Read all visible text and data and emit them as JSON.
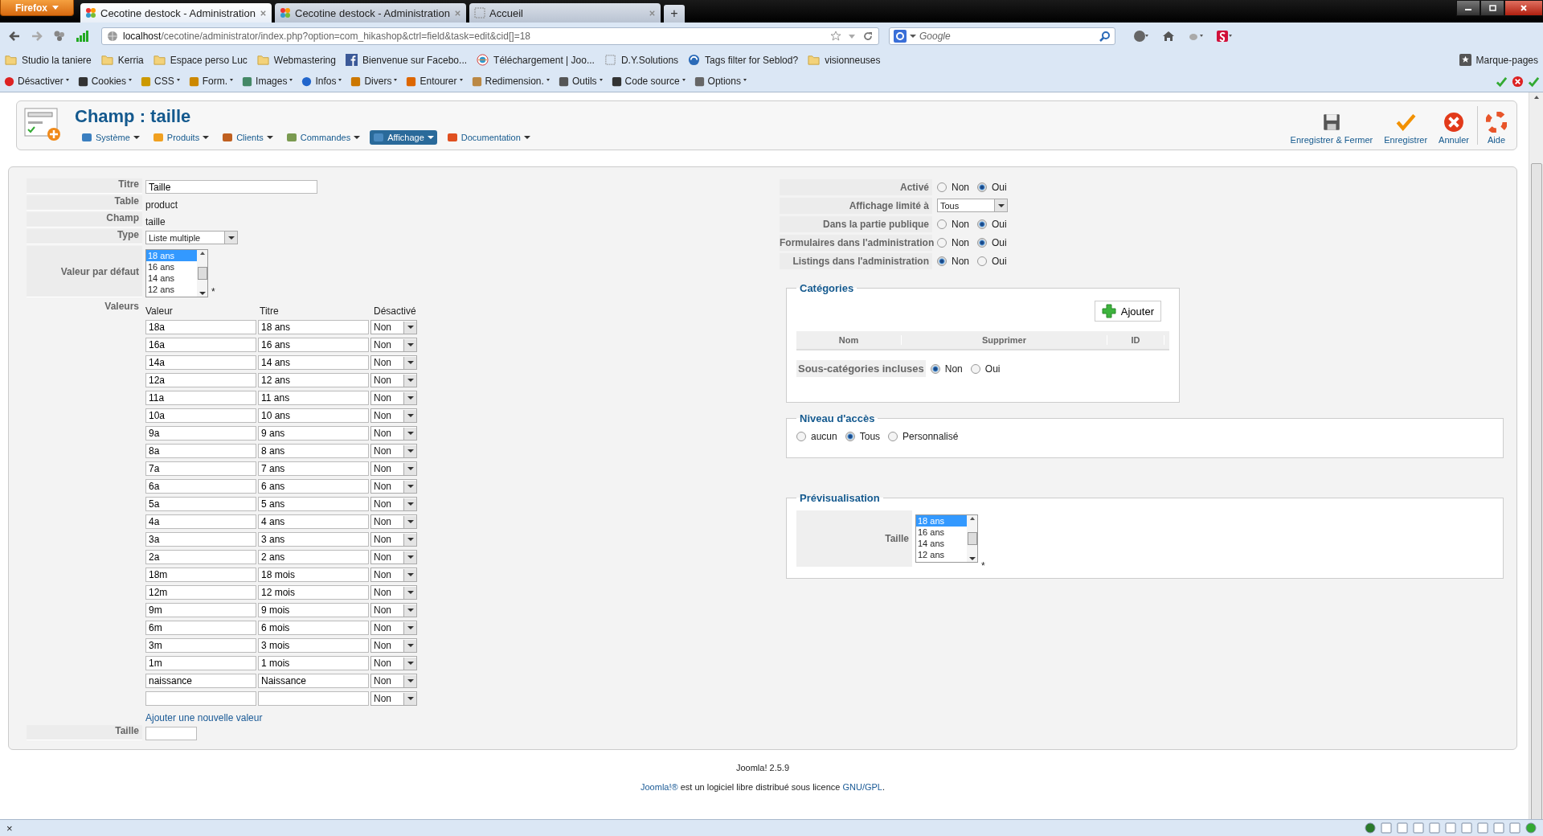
{
  "browser": {
    "app_button": "Firefox",
    "tabs": [
      {
        "title": "Cecotine destock - Administration",
        "selected": true
      },
      {
        "title": "Cecotine destock - Administration",
        "selected": false
      },
      {
        "title": "Accueil",
        "selected": false
      }
    ],
    "new_tab": "+",
    "url_host": "localhost",
    "url_path": "/cecotine/administrator/index.php?option=com_hikashop&ctrl=field&task=edit&cid[]=18",
    "search_placeholder": "Google",
    "bookmarks": [
      "Studio la taniere",
      "Kerria",
      "Espace perso Luc",
      "Webmastering",
      "Bienvenue sur Facebo...",
      "Téléchargement | Joo...",
      "D.Y.Solutions",
      "Tags filter for Seblod?",
      "visionneuses"
    ],
    "bookmarks_menu": "Marque-pages",
    "toolbar": [
      "Désactiver",
      "Cookies",
      "CSS",
      "Form.",
      "Images",
      "Infos",
      "Divers",
      "Entourer",
      "Redimension.",
      "Outils",
      "Code source",
      "Options"
    ]
  },
  "header": {
    "title": "Champ : taille",
    "menu": [
      {
        "label": "Système",
        "selected": false
      },
      {
        "label": "Produits",
        "selected": false
      },
      {
        "label": "Clients",
        "selected": false
      },
      {
        "label": "Commandes",
        "selected": false
      },
      {
        "label": "Affichage",
        "selected": true
      },
      {
        "label": "Documentation",
        "selected": false
      }
    ],
    "actions": [
      {
        "label": "Enregistrer & Fermer",
        "kind": "save"
      },
      {
        "label": "Enregistrer",
        "kind": "apply"
      },
      {
        "label": "Annuler",
        "kind": "cancel"
      },
      {
        "label": "Aide",
        "kind": "help"
      }
    ]
  },
  "form": {
    "titre": {
      "label": "Titre",
      "value": "Taille"
    },
    "table": {
      "label": "Table",
      "value": "product"
    },
    "champ": {
      "label": "Champ",
      "value": "taille"
    },
    "type": {
      "label": "Type",
      "value": "Liste multiple"
    },
    "default_value": {
      "label": "Valeur par défaut",
      "required_mark": "*",
      "options": [
        {
          "label": "18 ans",
          "selected": true
        },
        {
          "label": "16 ans",
          "selected": false
        },
        {
          "label": "14 ans",
          "selected": false
        },
        {
          "label": "12 ans",
          "selected": false
        }
      ]
    },
    "values": {
      "label": "Valeurs",
      "columns": [
        "Valeur",
        "Titre",
        "Désactivé"
      ],
      "rows": [
        {
          "value": "18a",
          "title": "18 ans",
          "disabled": "Non"
        },
        {
          "value": "16a",
          "title": "16 ans",
          "disabled": "Non"
        },
        {
          "value": "14a",
          "title": "14 ans",
          "disabled": "Non"
        },
        {
          "value": "12a",
          "title": "12 ans",
          "disabled": "Non"
        },
        {
          "value": "11a",
          "title": "11 ans",
          "disabled": "Non"
        },
        {
          "value": "10a",
          "title": "10 ans",
          "disabled": "Non"
        },
        {
          "value": "9a",
          "title": "9 ans",
          "disabled": "Non"
        },
        {
          "value": "8a",
          "title": "8 ans",
          "disabled": "Non"
        },
        {
          "value": "7a",
          "title": "7 ans",
          "disabled": "Non"
        },
        {
          "value": "6a",
          "title": "6 ans",
          "disabled": "Non"
        },
        {
          "value": "5a",
          "title": "5 ans",
          "disabled": "Non"
        },
        {
          "value": "4a",
          "title": "4 ans",
          "disabled": "Non"
        },
        {
          "value": "3a",
          "title": "3 ans",
          "disabled": "Non"
        },
        {
          "value": "2a",
          "title": "2 ans",
          "disabled": "Non"
        },
        {
          "value": "18m",
          "title": "18 mois",
          "disabled": "Non"
        },
        {
          "value": "12m",
          "title": "12 mois",
          "disabled": "Non"
        },
        {
          "value": "9m",
          "title": "9 mois",
          "disabled": "Non"
        },
        {
          "value": "6m",
          "title": "6 mois",
          "disabled": "Non"
        },
        {
          "value": "3m",
          "title": "3 mois",
          "disabled": "Non"
        },
        {
          "value": "1m",
          "title": "1 mois",
          "disabled": "Non"
        },
        {
          "value": "naissance",
          "title": "Naissance",
          "disabled": "Non"
        },
        {
          "disabled": "Non"
        }
      ],
      "add_link": "Ajouter une nouvelle valeur"
    },
    "size": {
      "label": "Taille"
    }
  },
  "settings": [
    {
      "label": "Activé",
      "kind": "radio",
      "options": [
        {
          "label": "Non",
          "selected": false
        },
        {
          "label": "Oui",
          "selected": true
        }
      ]
    },
    {
      "label": "Affichage limité à",
      "kind": "select",
      "value": "Tous"
    },
    {
      "label": "Dans la partie publique",
      "kind": "radio",
      "options": [
        {
          "label": "Non",
          "selected": false
        },
        {
          "label": "Oui",
          "selected": true
        }
      ]
    },
    {
      "label": "Formulaires dans l'administration",
      "kind": "radio",
      "options": [
        {
          "label": "Non",
          "selected": false
        },
        {
          "label": "Oui",
          "selected": true
        }
      ]
    },
    {
      "label": "Listings dans l'administration",
      "kind": "radio",
      "options": [
        {
          "label": "Non",
          "selected": true
        },
        {
          "label": "Oui",
          "selected": false
        }
      ]
    }
  ],
  "categories": {
    "legend": "Catégories",
    "add_button": "Ajouter",
    "columns": [
      "Nom",
      "Supprimer",
      "ID"
    ],
    "subcategories": {
      "label": "Sous-catégories incluses",
      "options": [
        {
          "label": "Non",
          "selected": true
        },
        {
          "label": "Oui",
          "selected": false
        }
      ]
    }
  },
  "access": {
    "legend": "Niveau d'accès",
    "options": [
      {
        "label": "aucun",
        "selected": false
      },
      {
        "label": "Tous",
        "selected": true
      },
      {
        "label": "Personnalisé",
        "selected": false
      }
    ]
  },
  "preview": {
    "legend": "Prévisualisation",
    "label": "Taille",
    "required_mark": "*",
    "options": [
      {
        "label": "18 ans",
        "selected": true
      },
      {
        "label": "16 ans",
        "selected": false
      },
      {
        "label": "14 ans",
        "selected": false
      },
      {
        "label": "12 ans",
        "selected": false
      }
    ]
  },
  "footer": {
    "version": "Joomla! 2.5.9",
    "license_link": "Joomla!®",
    "license_text": "est un logiciel libre distribué sous licence",
    "license_name": "GNU/GPL",
    "license_end": "."
  },
  "status_bar": {
    "close": "×"
  }
}
